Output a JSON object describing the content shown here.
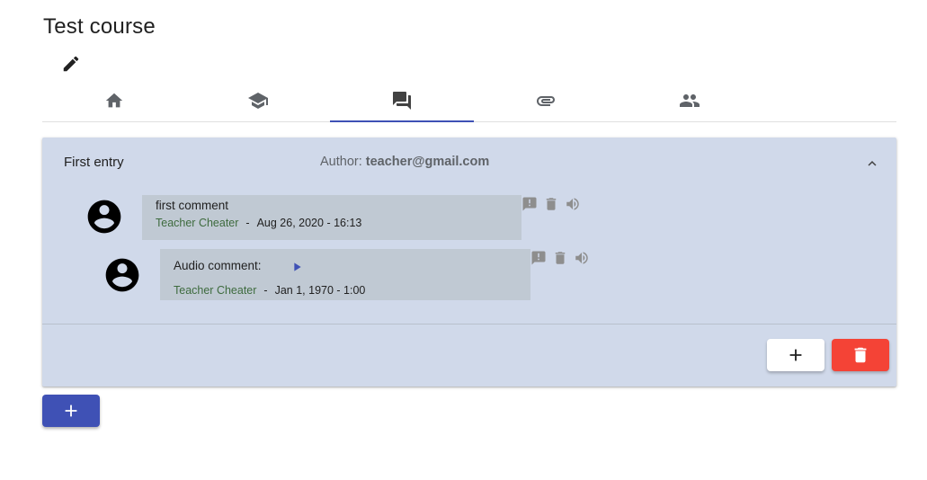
{
  "course": {
    "title": "Test course"
  },
  "icons": {
    "edit": "pencil-icon",
    "tabs": [
      "home-icon",
      "school-icon",
      "forum-icon",
      "attachment-icon",
      "people-icon"
    ],
    "comment_actions": [
      "report-comment-icon",
      "delete-icon",
      "volume-icon"
    ],
    "play": "play-icon",
    "add": "plus-icon",
    "trash": "delete-icon"
  },
  "colors": {
    "accent": "#3f51b5",
    "panel_background": "#d0d9ea",
    "comment_background": "#c0c9d3",
    "danger": "#f44336",
    "author_name": "#3e6b3e"
  },
  "entry": {
    "title": "First entry",
    "author_label": "Author:",
    "author_email": "teacher@gmail.com",
    "comments": [
      {
        "text": "first comment",
        "author": "Teacher Cheater",
        "separator": "-",
        "date": "Aug 26, 2020 - 16:13"
      },
      {
        "text": "Audio comment:",
        "author": "Teacher Cheater",
        "separator": "-",
        "date": "Jan 1, 1970 - 1:00"
      }
    ]
  }
}
